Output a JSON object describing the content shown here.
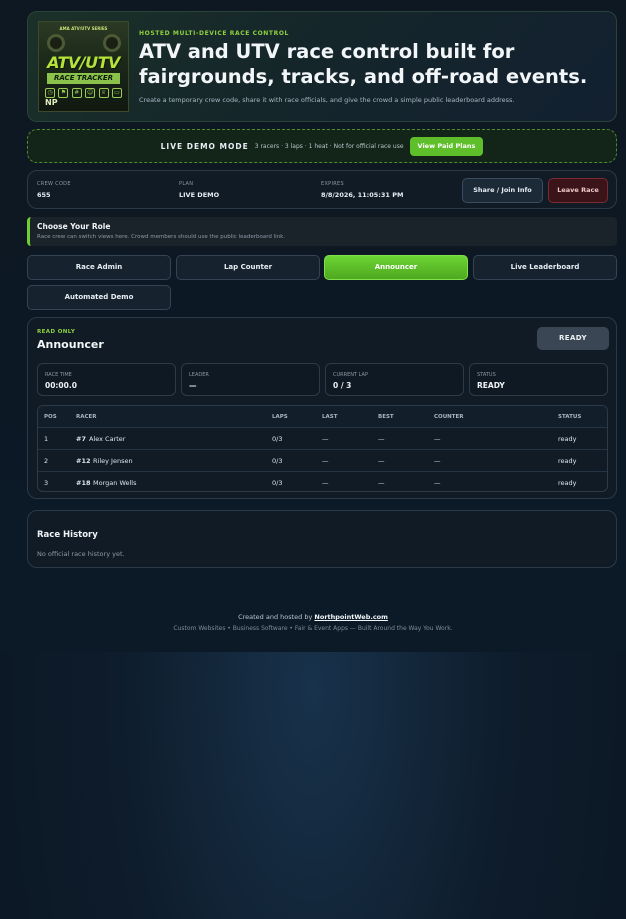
{
  "hero": {
    "logo": {
      "top_text": "AMA ATV/UTV SERIES",
      "title": "ATV/UTV",
      "subtitle": "RACE TRACKER",
      "brand": "NP"
    },
    "kicker": "HOSTED MULTI-DEVICE RACE CONTROL",
    "title": "ATV and UTV race control built for fairgrounds, tracks, and off-road events.",
    "subtitle": "Create a temporary crew code, share it with race officials, and give the crowd a simple public leaderboard address."
  },
  "demo": {
    "mode_label": "LIVE DEMO MODE",
    "info": "3 racers · 3 laps · 1 heat · Not for official race use",
    "button_label": "View Paid Plans"
  },
  "crew": {
    "code_label": "CREW CODE",
    "code_value": "655",
    "plan_label": "PLAN",
    "plan_value": "LIVE DEMO",
    "expires_label": "EXPIRES",
    "expires_value": "8/8/2026, 11:05:31 PM",
    "share_label": "Share / Join Info",
    "leave_label": "Leave Race"
  },
  "role": {
    "title": "Choose Your Role",
    "subtitle": "Race crew can switch views here. Crowd members should use the public leaderboard link."
  },
  "tabs": [
    {
      "label": "Race Admin"
    },
    {
      "label": "Lap Counter"
    },
    {
      "label": "Announcer"
    },
    {
      "label": "Live Leaderboard"
    },
    {
      "label": "Automated Demo"
    }
  ],
  "announcer": {
    "badge": "READ ONLY",
    "title": "Announcer",
    "status_badge": "READY",
    "stats": [
      {
        "label": "RACE TIME",
        "value": "00:00.0"
      },
      {
        "label": "LEADER",
        "value": "—"
      },
      {
        "label": "CURRENT LAP",
        "value": "0 / 3"
      },
      {
        "label": "STATUS",
        "value": "READY"
      }
    ],
    "columns": [
      "POS",
      "RACER",
      "LAPS",
      "LAST",
      "BEST",
      "COUNTER",
      "STATUS"
    ],
    "rows": [
      {
        "pos": "1",
        "num": "#7",
        "name": "Alex Carter",
        "laps": "0/3",
        "last": "—",
        "best": "—",
        "counter": "—",
        "status": "ready"
      },
      {
        "pos": "2",
        "num": "#12",
        "name": "Riley Jensen",
        "laps": "0/3",
        "last": "—",
        "best": "—",
        "counter": "—",
        "status": "ready"
      },
      {
        "pos": "3",
        "num": "#18",
        "name": "Morgan Wells",
        "laps": "0/3",
        "last": "—",
        "best": "—",
        "counter": "—",
        "status": "ready"
      }
    ]
  },
  "history": {
    "title": "Race History",
    "empty": "No official race history yet."
  },
  "footer": {
    "prefix": "Created and hosted by ",
    "link": "NorthpointWeb.com",
    "tagline": "Custom Websites • Business Software • Fair & Event Apps — Built Around the Way You Work."
  },
  "colors": {
    "accent_green": "#5fbf2a",
    "danger": "#7a2a30",
    "background": "#0e1822"
  }
}
